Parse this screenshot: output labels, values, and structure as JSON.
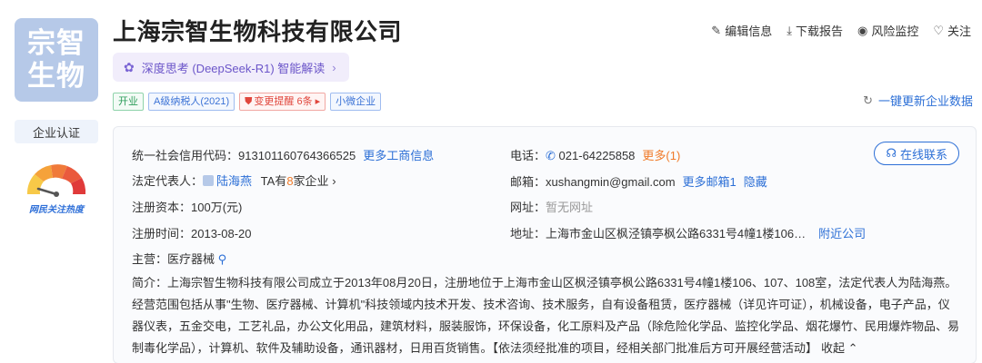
{
  "logo": {
    "line1": "宗智",
    "line2": "生物"
  },
  "sidebar": {
    "cert_label": "企业认证",
    "heat_label": "网民关注热度"
  },
  "company": {
    "name": "上海宗智生物科技有限公司"
  },
  "ai": {
    "label": "深度思考 (DeepSeek-R1) 智能解读",
    "chevron": "›"
  },
  "tags": [
    {
      "label": "开业"
    },
    {
      "label": "A级纳税人(2021)"
    },
    {
      "label": "变更提醒 6条 ▸"
    },
    {
      "label": "小微企业"
    }
  ],
  "actions": {
    "edit": "编辑信息",
    "download": "下载报告",
    "monitor": "风险监控",
    "follow": "关注"
  },
  "refresh": {
    "label": "一键更新企业数据"
  },
  "info": {
    "credit_code_label": "统一社会信用代码：",
    "credit_code": "913101160764366525",
    "more_business": "更多工商信息",
    "legal_rep_label": "法定代表人：",
    "legal_rep": "陆海燕",
    "legal_rep_extra_pre": "TA有",
    "legal_rep_count": "8",
    "legal_rep_extra_post": "家企业",
    "capital_label": "注册资本：",
    "capital": "100万(元)",
    "reg_time_label": "注册时间：",
    "reg_time": "2013-08-20",
    "main_label": "主营：",
    "main": "医疗器械",
    "phone_label": "电话：",
    "phone": "021-64225858",
    "phone_more": "更多(1)",
    "email_label": "邮箱：",
    "email": "xushangmin@gmail.com",
    "email_more": "更多邮箱1",
    "email_hide": "隐藏",
    "website_label": "网址：",
    "website": "暂无网址",
    "address_label": "地址：",
    "address": "上海市金山区枫泾镇亭枫公路6331号4幢1楼106…",
    "nearby": "附近公司",
    "contact_btn": "在线联系",
    "intro": "简介：上海宗智生物科技有限公司成立于2013年08月20日，注册地位于上海市金山区枫泾镇亭枫公路6331号4幢1楼106、107、108室，法定代表人为陆海燕。经营范围包括从事\"生物、医疗器械、计算机\"科技领域内技术开发、技术咨询、技术服务，自有设备租赁，医疗器械（详见许可证），机械设备，电子产品，仪器仪表，五金交电，工艺礼品，办公文化用品，建筑材料，服装服饰，环保设备，化工原料及产品（除危险化学品、监控化学品、烟花爆竹、民用爆炸物品、易制毒化学品），计算机、软件及辅助设备，通讯器材，日用百货销售。【依法须经批准的项目，经相关部门批准后方可开展经营活动】",
    "collapse": "收起 ⌃"
  }
}
